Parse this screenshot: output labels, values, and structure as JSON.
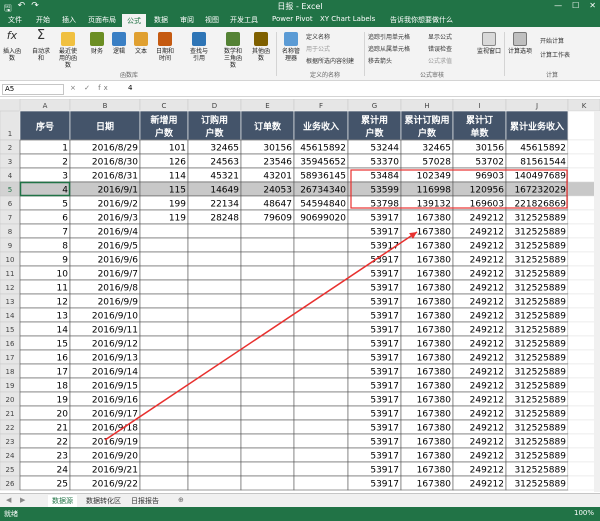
{
  "window": {
    "title": "日报 - Excel"
  },
  "tabs": [
    "文件",
    "开始",
    "插入",
    "页面布局",
    "公式",
    "数据",
    "审阅",
    "视图",
    "开发工具",
    "Power Pivot",
    "XY Chart Labels",
    "告诉我你想要做什么"
  ],
  "ribbon": {
    "buttons": [
      {
        "label": "插入函数",
        "icon": "fx-icon"
      },
      {
        "label": "自动求和",
        "icon": "sigma-icon"
      },
      {
        "label": "最近使用的函数",
        "icon": "star-icon"
      },
      {
        "label": "财务",
        "icon": "book-icon"
      },
      {
        "label": "逻辑",
        "icon": "book-icon"
      },
      {
        "label": "文本",
        "icon": "text-book-icon"
      },
      {
        "label": "日期和时间",
        "icon": "clock-book-icon"
      },
      {
        "label": "查找与引用",
        "icon": "magnifier-book-icon"
      },
      {
        "label": "数学和三角函数",
        "icon": "theta-book-icon"
      },
      {
        "label": "其他函数",
        "icon": "book-icon"
      },
      {
        "label": "名称管理器",
        "icon": "tag-icon"
      },
      {
        "label": "监视窗口",
        "icon": "glasses-icon"
      },
      {
        "label": "计算选项",
        "icon": "calculator-icon"
      }
    ],
    "small": [
      "定义名称",
      "用于公式",
      "根据所选内容创建",
      "追踪引用单元格",
      "追踪从属单元格",
      "移去箭头",
      "显示公式",
      "错误检查",
      "公式求值",
      "开始计算",
      "计算工作表"
    ],
    "groups": [
      "函数库",
      "定义的名称",
      "公式审核",
      "计算"
    ]
  },
  "formula_bar": {
    "name_box": "A5",
    "fx": "× ✓ fx",
    "value": "4"
  },
  "columns": [
    "A",
    "B",
    "C",
    "D",
    "E",
    "F",
    "G",
    "H",
    "I",
    "J",
    "K"
  ],
  "header_row": [
    "序号",
    "日期",
    "新增用户数",
    "订购用户数",
    "订单数",
    "业务收入",
    "累计用户数",
    "累计订购用户数",
    "累计订单数",
    "累计业务收入"
  ],
  "rows": [
    [
      "1",
      "2016/8/29",
      "101",
      "32465",
      "30156",
      "45615892",
      "53244",
      "32465",
      "30156",
      "45615892"
    ],
    [
      "2",
      "2016/8/30",
      "126",
      "24563",
      "23546",
      "35945652",
      "53370",
      "57028",
      "53702",
      "81561544"
    ],
    [
      "3",
      "2016/8/31",
      "114",
      "45321",
      "43201",
      "58936145",
      "53484",
      "102349",
      "96903",
      "140497689"
    ],
    [
      "4",
      "2016/9/1",
      "115",
      "14649",
      "24053",
      "26734340",
      "53599",
      "116998",
      "120956",
      "167232029"
    ],
    [
      "5",
      "2016/9/2",
      "199",
      "22134",
      "48647",
      "54594840",
      "53798",
      "139132",
      "169603",
      "221826869"
    ],
    [
      "6",
      "2016/9/3",
      "119",
      "28248",
      "79609",
      "90699020",
      "53917",
      "167380",
      "249212",
      "312525889"
    ],
    [
      "7",
      "2016/9/4",
      "",
      "",
      "",
      "",
      "53917",
      "167380",
      "249212",
      "312525889"
    ],
    [
      "8",
      "2016/9/5",
      "",
      "",
      "",
      "",
      "53917",
      "167380",
      "249212",
      "312525889"
    ],
    [
      "9",
      "2016/9/6",
      "",
      "",
      "",
      "",
      "53917",
      "167380",
      "249212",
      "312525889"
    ],
    [
      "10",
      "2016/9/7",
      "",
      "",
      "",
      "",
      "53917",
      "167380",
      "249212",
      "312525889"
    ],
    [
      "11",
      "2016/9/8",
      "",
      "",
      "",
      "",
      "53917",
      "167380",
      "249212",
      "312525889"
    ],
    [
      "12",
      "2016/9/9",
      "",
      "",
      "",
      "",
      "53917",
      "167380",
      "249212",
      "312525889"
    ],
    [
      "13",
      "2016/9/10",
      "",
      "",
      "",
      "",
      "53917",
      "167380",
      "249212",
      "312525889"
    ],
    [
      "14",
      "2016/9/11",
      "",
      "",
      "",
      "",
      "53917",
      "167380",
      "249212",
      "312525889"
    ],
    [
      "15",
      "2016/9/12",
      "",
      "",
      "",
      "",
      "53917",
      "167380",
      "249212",
      "312525889"
    ],
    [
      "16",
      "2016/9/13",
      "",
      "",
      "",
      "",
      "53917",
      "167380",
      "249212",
      "312525889"
    ],
    [
      "17",
      "2016/9/14",
      "",
      "",
      "",
      "",
      "53917",
      "167380",
      "249212",
      "312525889"
    ],
    [
      "18",
      "2016/9/15",
      "",
      "",
      "",
      "",
      "53917",
      "167380",
      "249212",
      "312525889"
    ],
    [
      "19",
      "2016/9/16",
      "",
      "",
      "",
      "",
      "53917",
      "167380",
      "249212",
      "312525889"
    ],
    [
      "20",
      "2016/9/17",
      "",
      "",
      "",
      "",
      "53917",
      "167380",
      "249212",
      "312525889"
    ],
    [
      "21",
      "2016/9/18",
      "",
      "",
      "",
      "",
      "53917",
      "167380",
      "249212",
      "312525889"
    ],
    [
      "22",
      "2016/9/19",
      "",
      "",
      "",
      "",
      "53917",
      "167380",
      "249212",
      "312525889"
    ],
    [
      "23",
      "2016/9/20",
      "",
      "",
      "",
      "",
      "53917",
      "167380",
      "249212",
      "312525889"
    ],
    [
      "24",
      "2016/9/21",
      "",
      "",
      "",
      "",
      "53917",
      "167380",
      "249212",
      "312525889"
    ],
    [
      "25",
      "2016/9/22",
      "",
      "",
      "",
      "",
      "53917",
      "167380",
      "249212",
      "312525889"
    ]
  ],
  "selected_row_index": 3,
  "sheets": [
    "数据源",
    "数据转化区",
    "日报报告"
  ],
  "active_sheet": 0,
  "status": {
    "text": "就绪",
    "zoom": "100%"
  },
  "colors": {
    "excel_green": "#217346",
    "header_fill": "#44546a",
    "highlight_border": "#e8312f",
    "arrow": "#e8312f",
    "selected_row": "#c8c8c8"
  }
}
